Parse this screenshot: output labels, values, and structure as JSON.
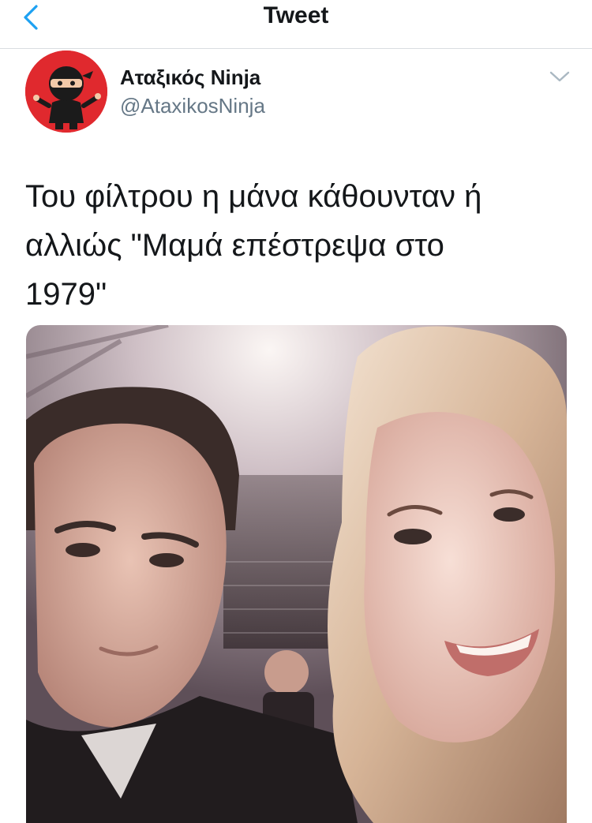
{
  "nav": {
    "title": "Tweet",
    "back_icon": "chevron-left-icon",
    "accent": "#1da1f2"
  },
  "tweet": {
    "author": {
      "display_name": "Αταξικός Ninja",
      "handle": "@AtaxikosNinja",
      "avatar_icon": "ninja-avatar-icon",
      "avatar_color": "#e0292e"
    },
    "menu_icon": "chevron-down-icon",
    "text": "Του φίλτρου η μάνα κάθουνταν ή\nαλλιώς \"Μαμά επέστρεψα στο\n1979\"",
    "media": {
      "type": "photo"
    }
  }
}
